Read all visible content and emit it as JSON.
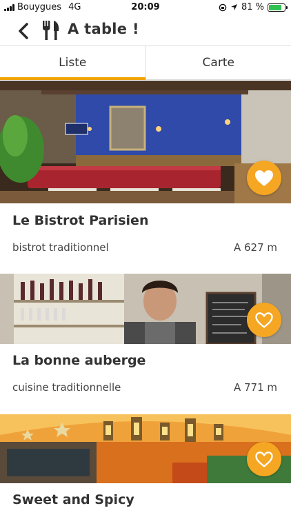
{
  "status": {
    "carrier": "Bouygues",
    "network": "4G",
    "time": "20:09",
    "battery_text": "81 %",
    "battery_level": 0.81
  },
  "header": {
    "title": "A table !",
    "back_icon": "chevron-left-icon",
    "logo_icon": "cutlery-icon"
  },
  "tabs": [
    {
      "label": "Liste",
      "active": true
    },
    {
      "label": "Carte",
      "active": false
    }
  ],
  "restaurants": [
    {
      "name": "Le Bistrot Parisien",
      "category": "bistrot traditionnel",
      "distance": "A 627 m",
      "favorite": true
    },
    {
      "name": "La bonne auberge",
      "category": "cuisine traditionnelle",
      "distance": "A 771 m",
      "favorite": false
    },
    {
      "name": "Sweet and Spicy",
      "category": "",
      "distance": "",
      "favorite": false
    }
  ],
  "colors": {
    "accent": "#f5a623",
    "tab_indicator": "#f0a500",
    "battery": "#2fc24f"
  }
}
